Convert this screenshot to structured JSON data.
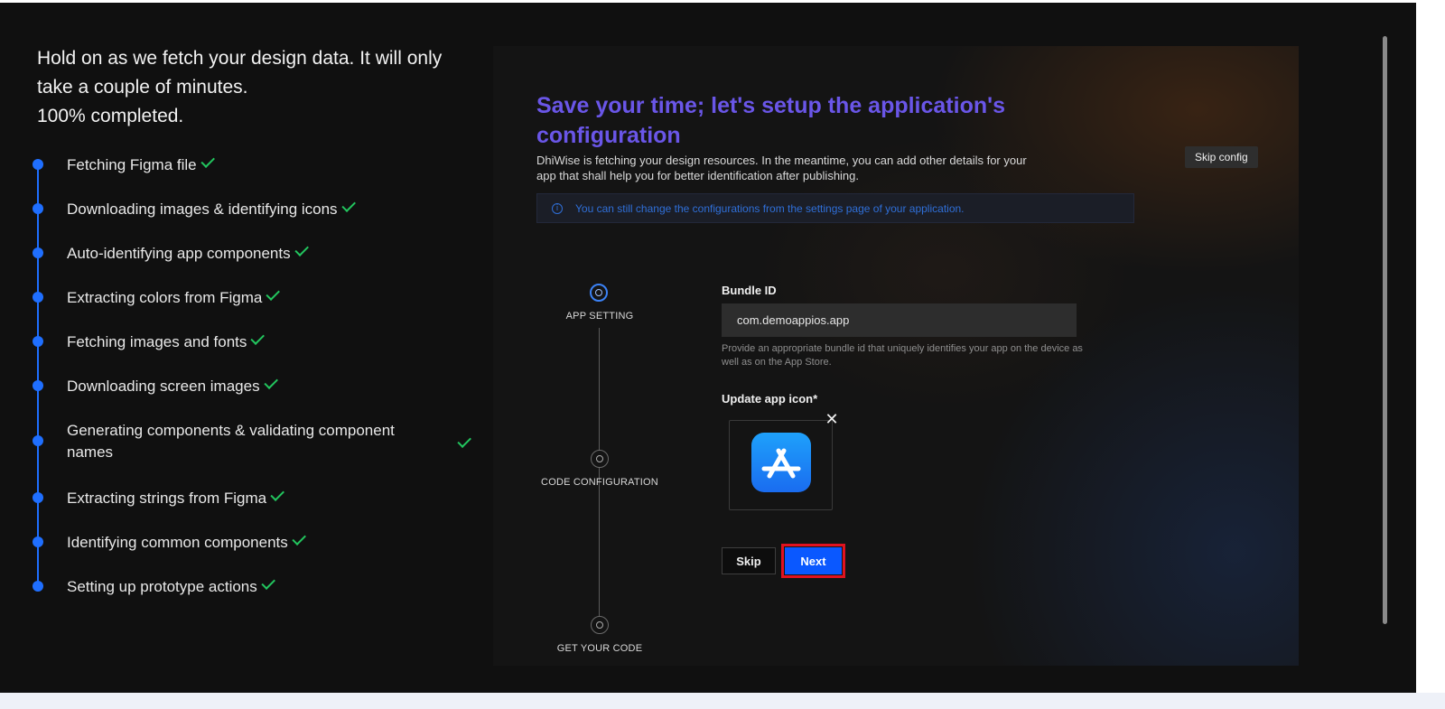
{
  "progress": {
    "title": "Hold on as we fetch your design data. It will only take a couple of minutes.",
    "percent_text": "100% completed.",
    "steps": [
      {
        "label": "Fetching Figma file",
        "done": true
      },
      {
        "label": "Downloading images & identifying icons",
        "done": true
      },
      {
        "label": "Auto-identifying app components",
        "done": true
      },
      {
        "label": "Extracting colors from Figma",
        "done": true
      },
      {
        "label": "Fetching images and fonts",
        "done": true
      },
      {
        "label": "Downloading screen images",
        "done": true
      },
      {
        "label": "Generating components & validating component names",
        "done": true
      },
      {
        "label": "Extracting strings from Figma",
        "done": true
      },
      {
        "label": "Identifying common components",
        "done": true
      },
      {
        "label": "Setting up prototype actions",
        "done": true
      }
    ]
  },
  "config": {
    "title": "Save your time; let's setup the application's configuration",
    "description": "DhiWise is fetching your design resources. In the meantime, you can add other details for your app that shall help you for better identification after publishing.",
    "skip_config_label": "Skip config",
    "info_icon": "info-circle-icon",
    "info_text": "You can still change the configurations from the settings page of your application.",
    "stepper": [
      {
        "label": "APP SETTING",
        "active": true
      },
      {
        "label": "CODE CONFIGURATION",
        "active": false
      },
      {
        "label": "GET YOUR CODE",
        "active": false
      }
    ],
    "bundle_id_label": "Bundle ID",
    "bundle_id_value": "com.demoappios.app",
    "bundle_id_help": "Provide an appropriate bundle id that uniquely identifies your app on the device as well as on the App Store.",
    "app_icon_label": "Update app icon*",
    "app_icon_name": "app-store-icon",
    "remove_icon": "close-icon",
    "skip_label": "Skip",
    "next_label": "Next"
  },
  "colors": {
    "accent_blue": "#1f6fff",
    "title_purple": "#6a56e8",
    "check_green": "#22c55e",
    "highlight_red": "#e0121f"
  }
}
